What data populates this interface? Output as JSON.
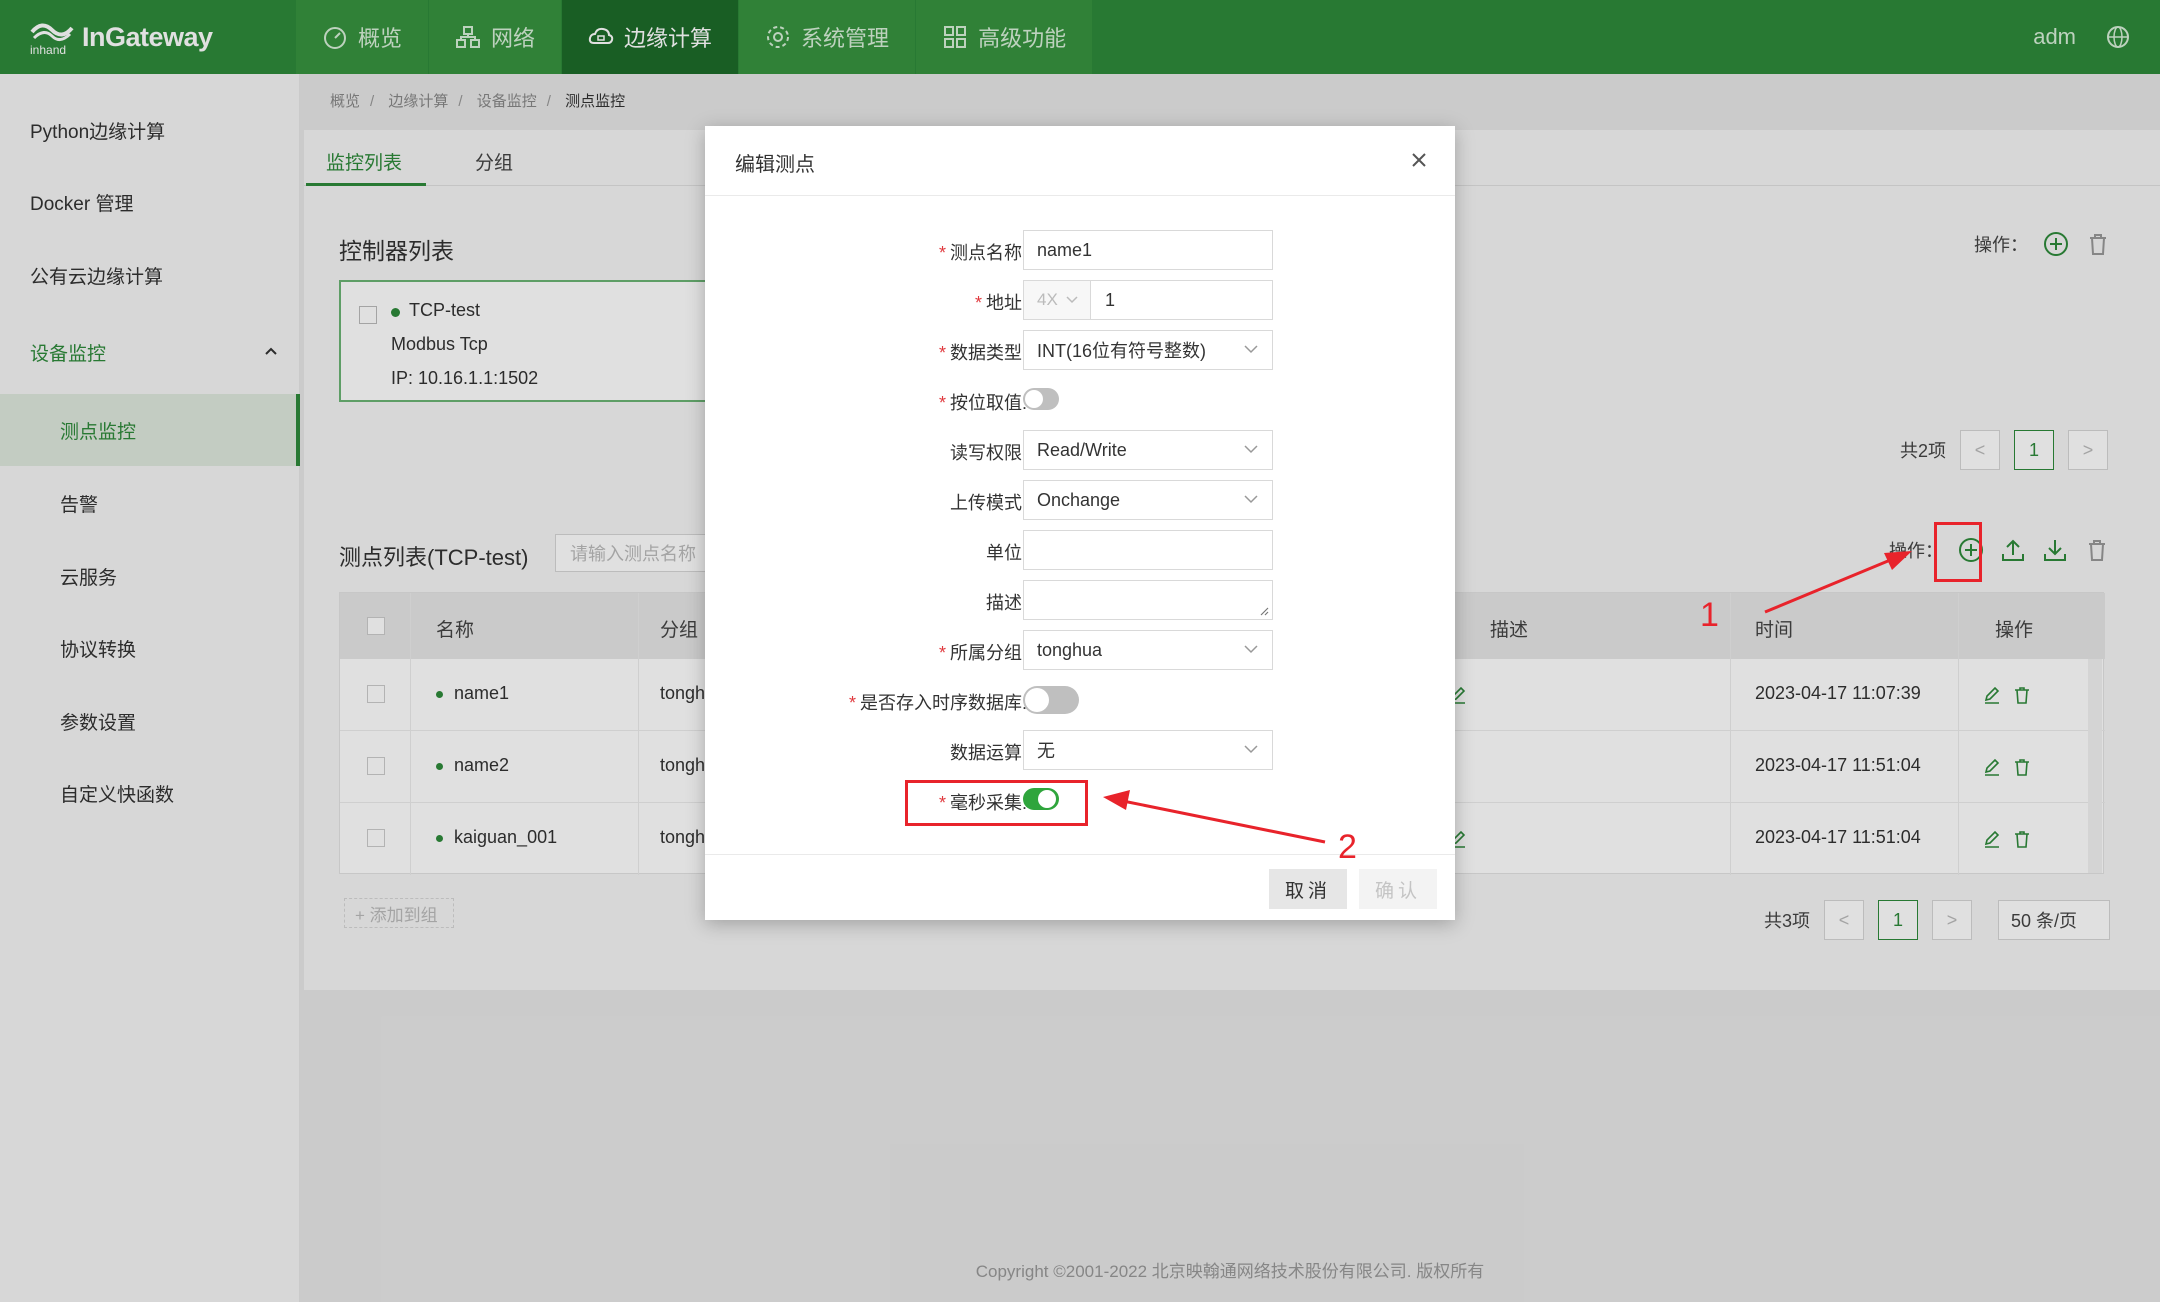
{
  "brand": {
    "name": "InGateway",
    "mark_text": "inhand"
  },
  "nav": [
    {
      "label": "概览",
      "icon": "dashboard-icon"
    },
    {
      "label": "网络",
      "icon": "network-icon"
    },
    {
      "label": "边缘计算",
      "icon": "cloud-icon",
      "active": true
    },
    {
      "label": "系统管理",
      "icon": "gear-icon"
    },
    {
      "label": "高级功能",
      "icon": "grid-icon"
    }
  ],
  "user": "adm",
  "sidebar": {
    "items": [
      {
        "label": "Python边缘计算"
      },
      {
        "label": "Docker 管理"
      },
      {
        "label": "公有云边缘计算"
      },
      {
        "label": "设备监控"
      },
      {
        "label": "测点监控"
      },
      {
        "label": "告警"
      },
      {
        "label": "云服务"
      },
      {
        "label": "协议转换"
      },
      {
        "label": "参数设置"
      },
      {
        "label": "自定义快函数"
      }
    ]
  },
  "breadcrumb": [
    "概览",
    "边缘计算",
    "设备监控",
    "测点监控"
  ],
  "tabs": [
    "监控列表",
    "分组"
  ],
  "controller": {
    "title": "控制器列表",
    "ops_label": "操作：",
    "card": {
      "name": "TCP-test",
      "protocol": "Modbus Tcp",
      "ip": "IP: 10.16.1.1:1502"
    },
    "pager": {
      "total": "共2项",
      "page": "1",
      "prev": "<",
      "next": ">"
    }
  },
  "points": {
    "title": "测点列表(TCP-test)",
    "search_placeholder": "请输入测点名称",
    "ops_label": "操作：",
    "columns": [
      "名称",
      "分组",
      "描述",
      "时间",
      "操作"
    ],
    "rows": [
      {
        "name": "name1",
        "group": "tonghu",
        "time": "2023-04-17 11:07:39"
      },
      {
        "name": "name2",
        "group": "tonghu",
        "time": "2023-04-17 11:51:04"
      },
      {
        "name": "kaiguan_001",
        "group": "tonghu",
        "time": "2023-04-17 11:51:04"
      }
    ],
    "add_group": "+ 添加到组",
    "pager": {
      "total": "共3项",
      "page": "1",
      "prev": "<",
      "next": ">",
      "size": "50 条/页"
    }
  },
  "footer": "Copyright ©2001-2022 北京映翰通网络技术股份有限公司. 版权所有",
  "dialog": {
    "title": "编辑测点",
    "close": "X",
    "fields": {
      "name": {
        "label": "测点名称:",
        "value": "name1"
      },
      "address": {
        "label": "地址:",
        "prefix": "4X",
        "value": "1"
      },
      "datatype": {
        "label": "数据类型:",
        "value": "INT(16位有符号整数)"
      },
      "bit": {
        "label": "按位取值:",
        "on": false
      },
      "rw": {
        "label": "读写权限:",
        "value": "Read/Write"
      },
      "upload": {
        "label": "上传模式:",
        "value": "Onchange"
      },
      "unit": {
        "label": "单位:",
        "value": ""
      },
      "desc": {
        "label": "描述:",
        "value": ""
      },
      "group": {
        "label": "所属分组:",
        "value": "tonghua"
      },
      "tsdb": {
        "label": "是否存入时序数据库:",
        "on": false
      },
      "calc": {
        "label": "数据运算:",
        "value": "无"
      },
      "ms": {
        "label": "毫秒采集:",
        "on": true
      }
    },
    "cancel": "取消",
    "ok": "确认"
  },
  "annotations": [
    "1",
    "2"
  ],
  "colors": {
    "primary": "#2e8a3b",
    "annotation": "#e8232b"
  }
}
